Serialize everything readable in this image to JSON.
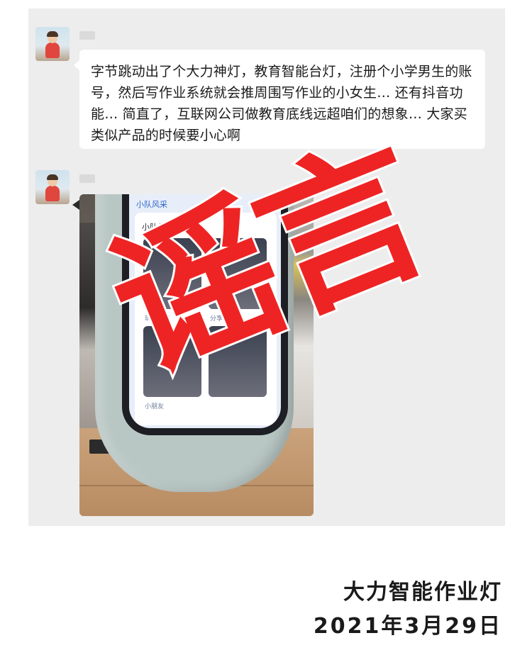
{
  "chat": {
    "messages": [
      {
        "type": "text",
        "text": "字节跳动出了个大力神灯，教育智能台灯，注册个小学男生的账号，然后写作业系统就会推周围写作业的小女生… 还有抖音功能… 简直了，互联网公司做教育底线远超咱们的想象… 大家买类似产品的时候要小心啊"
      },
      {
        "type": "image",
        "screen_header": "小队风采",
        "screen_subtitle": "小队任务风采",
        "thumb_captions": [
          "玩玩分享",
          "分享",
          "小朋友"
        ]
      }
    ]
  },
  "overlay": {
    "stamp_text": "谣言",
    "stamp_color": "#ee2424"
  },
  "caption": {
    "title": "大力智能作业灯",
    "date": "2021年3月29日"
  },
  "colors": {
    "chat_bg": "#ededed",
    "bubble_bg": "#ffffff",
    "text": "#1b1b1b"
  }
}
